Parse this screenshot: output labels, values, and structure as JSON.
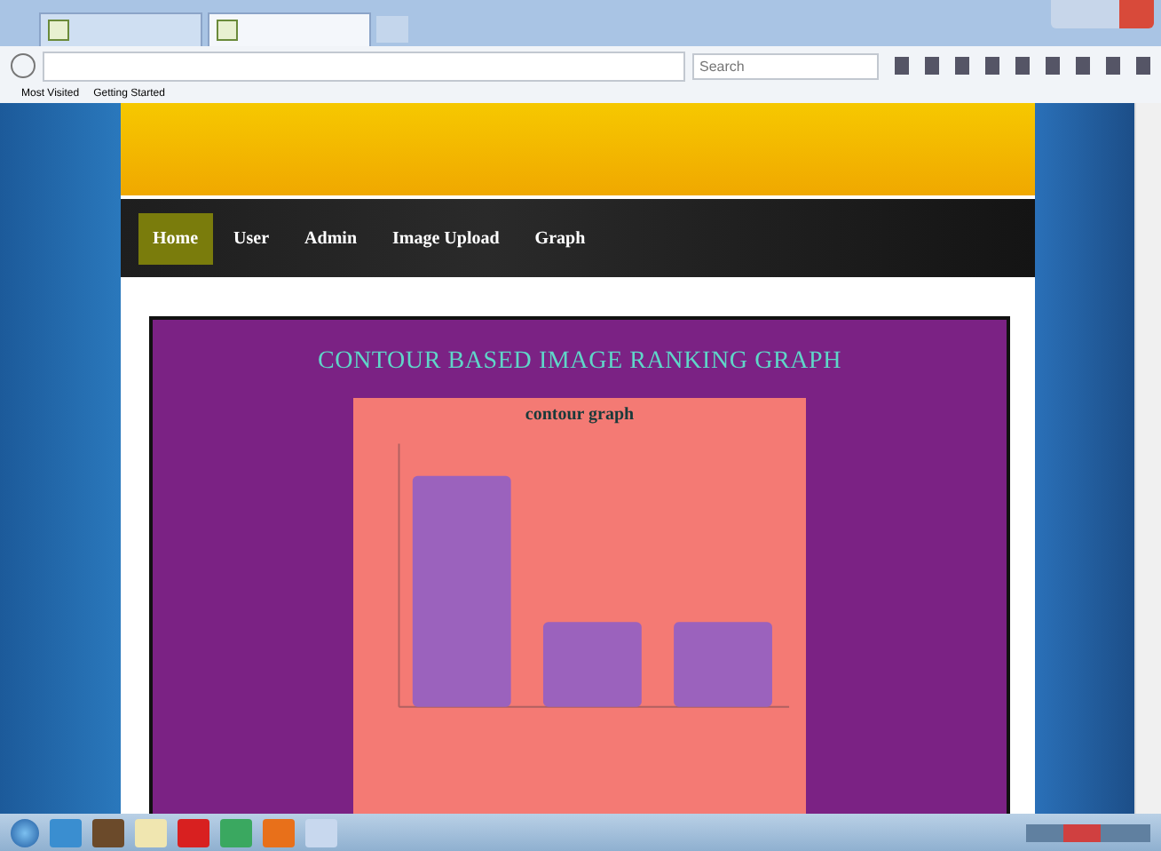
{
  "browser": {
    "search": {
      "placeholder": "Search"
    },
    "bookmarks": [
      "Most Visited",
      "Getting Started"
    ]
  },
  "nav": [
    {
      "label": "Home",
      "selected": true
    },
    {
      "label": "User",
      "selected": false
    },
    {
      "label": "Admin",
      "selected": false
    },
    {
      "label": "Image Upload",
      "selected": false
    },
    {
      "label": "Graph",
      "selected": false
    }
  ],
  "heading": "CONTOUR BASED IMAGE RANKING GRAPH",
  "chart": {
    "title": "contour graph"
  }
}
